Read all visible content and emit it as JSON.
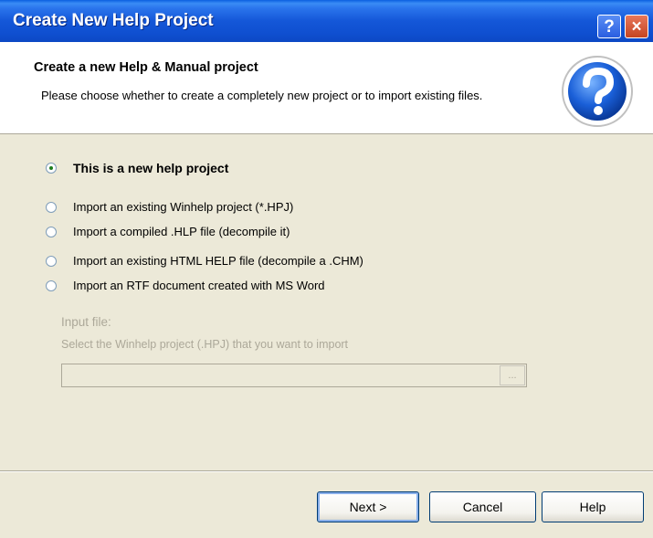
{
  "window": {
    "title": "Create New Help Project",
    "help_button": "?",
    "close_button": "×"
  },
  "header": {
    "title": "Create a new Help & Manual project",
    "description": "Please choose whether to create a completely new project or to import existing files.",
    "icon": "help-question-icon"
  },
  "options": [
    {
      "label": "This is a new help project",
      "checked": true
    },
    {
      "label": "Import an existing Winhelp project (*.HPJ)",
      "checked": false
    },
    {
      "label": "Import a compiled .HLP file (decompile it)",
      "checked": false
    },
    {
      "label": "Import an existing HTML HELP file (decompile a .CHM)",
      "checked": false
    },
    {
      "label": "Import an RTF document created with MS Word",
      "checked": false
    }
  ],
  "input_file": {
    "label": "Input file:",
    "hint": "Select the Winhelp project (.HPJ) that you want to import",
    "value": "",
    "browse_label": "..."
  },
  "buttons": {
    "next": "Next >",
    "cancel": "Cancel",
    "help": "Help"
  },
  "colors": {
    "title_bar": "#0f4fd0",
    "dialog_bg": "#ece9d8",
    "header_bg": "#ffffff",
    "disabled_text": "#aca899"
  }
}
